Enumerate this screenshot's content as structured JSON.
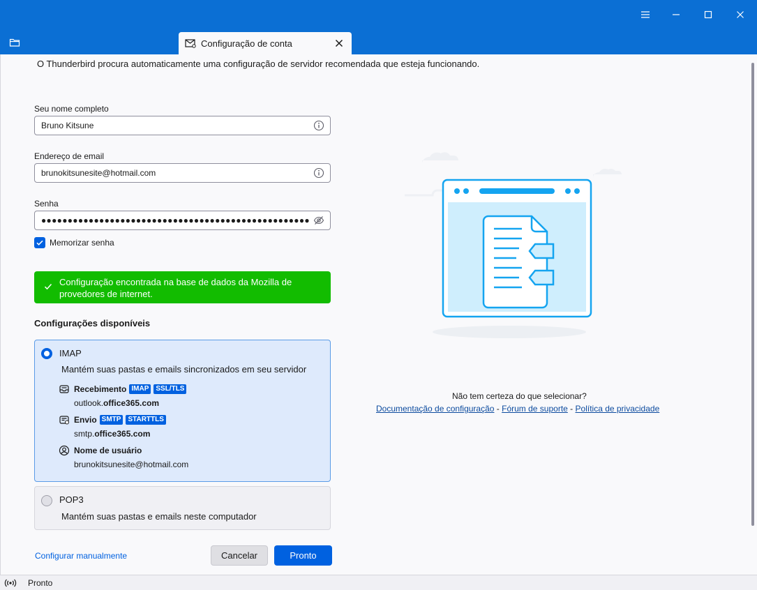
{
  "window": {
    "minimize_icon": "minimize-icon",
    "maximize_icon": "maximize-icon",
    "close_icon": "close-icon"
  },
  "tab": {
    "title": "Configuração de conta"
  },
  "intro": "O Thunderbird procura automaticamente uma configuração de servidor recomendada que esteja funcionando.",
  "form": {
    "name_label": "Seu nome completo",
    "name_value": "Bruno Kitsune",
    "email_label": "Endereço de email",
    "email_value": "brunokitsunesite@hotmail.com",
    "password_label": "Senha",
    "password_value": "●●●●●●●●●●●●●●●●●●●●●●●●●●●●●●●●●●●●●●●●●●●●●●●●●●●",
    "remember_label": "Memorizar senha",
    "remember_checked": true
  },
  "success_message": "Configuração encontrada na base de dados da Mozilla de provedores de internet.",
  "configs": {
    "title": "Configurações disponíveis",
    "imap": {
      "name": "IMAP",
      "description": "Mantém suas pastas e emails sincronizados em seu servidor",
      "incoming_label": "Recebimento",
      "incoming_badges": [
        "IMAP",
        "SSL/TLS"
      ],
      "incoming_host_prefix": "outlook.",
      "incoming_host_domain": "office365.com",
      "outgoing_label": "Envio",
      "outgoing_badges": [
        "SMTP",
        "STARTTLS"
      ],
      "outgoing_host_prefix": "smtp.",
      "outgoing_host_domain": "office365.com",
      "username_label": "Nome de usuário",
      "username_value": "brunokitsunesite@hotmail.com"
    },
    "pop3": {
      "name": "POP3",
      "description": "Mantém suas pastas e emails neste computador"
    }
  },
  "actions": {
    "manual": "Configurar manualmente",
    "cancel": "Cancelar",
    "done": "Pronto"
  },
  "help": {
    "question": "Não tem certeza do que selecionar?",
    "doc_link": "Documentação de configuração",
    "forum_link": "Fórum de suporte",
    "privacy_link": "Política de privacidade",
    "separator": " - "
  },
  "status": {
    "text": "Pronto"
  },
  "colors": {
    "accent": "#0061e0",
    "titlebar": "#0b6fd4",
    "success": "#12bc00",
    "selected_bg": "#deeafc"
  }
}
